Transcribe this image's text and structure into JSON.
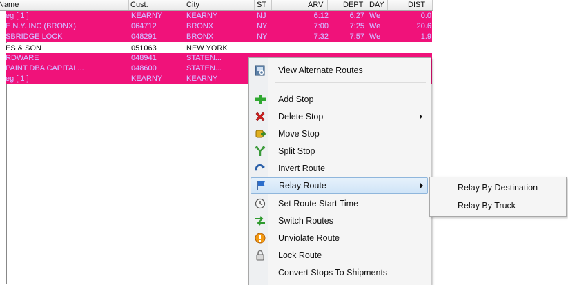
{
  "grid": {
    "columns": [
      "Name",
      "Cust.",
      "City",
      "ST",
      "ARV",
      "DEPT",
      "DAY",
      "DIST"
    ],
    "rows": [
      {
        "style": "pink",
        "name": "eg [ 1 ]",
        "cust": "KEARNY",
        "city": "KEARNY",
        "st": "NJ",
        "arv": "6:12",
        "dept": "6:27",
        "day": "We",
        "dist": "0.0"
      },
      {
        "style": "pink",
        "name": "E N.Y. INC (BRONX)",
        "cust": "064712",
        "city": "BRONX",
        "st": "NY",
        "arv": "7:00",
        "dept": "7:25",
        "day": "We",
        "dist": "20.6"
      },
      {
        "style": "pink",
        "name": "SBRIDGE LOCK",
        "cust": "048291",
        "city": "BRONX",
        "st": "NY",
        "arv": "7:32",
        "dept": "7:57",
        "day": "We",
        "dist": "1.9"
      },
      {
        "style": "white",
        "name": "ES & SON",
        "cust": "051063",
        "city": "NEW YORK",
        "st": "",
        "arv": "",
        "dept": "",
        "day": "",
        "dist": ""
      },
      {
        "style": "pink",
        "name": "RDWARE",
        "cust": "048941",
        "city": "STATEN...",
        "st": "",
        "arv": "",
        "dept": "",
        "day": "",
        "dist": ""
      },
      {
        "style": "pink",
        "name": "PAINT DBA CAPITAL...",
        "cust": "048600",
        "city": "STATEN...",
        "st": "",
        "arv": "",
        "dept": "",
        "day": "",
        "dist": ""
      },
      {
        "style": "pink",
        "name": "eg [ 1 ]",
        "cust": "KEARNY",
        "city": "KEARNY",
        "st": "",
        "arv": "",
        "dept": "",
        "day": "",
        "dist": ""
      }
    ]
  },
  "menu": {
    "items": [
      {
        "label": "View Alternate Routes",
        "icon": "view-routes-icon"
      },
      {
        "label": "Add Stop",
        "icon": "add-plus-icon"
      },
      {
        "label": "Delete Stop",
        "icon": "delete-x-icon",
        "submenu": true
      },
      {
        "label": "Move Stop",
        "icon": "move-stop-icon"
      },
      {
        "label": "Split Stop",
        "icon": "split-icon"
      },
      {
        "label": "Invert Route",
        "icon": "invert-arrow-icon"
      },
      {
        "label": "Relay Route",
        "icon": "flag-icon",
        "submenu": true,
        "highlighted": true
      },
      {
        "label": "Set Route Start Time",
        "icon": "clock-icon"
      },
      {
        "label": "Switch Routes",
        "icon": "switch-arrows-icon"
      },
      {
        "label": "Unviolate Route",
        "icon": "warning-icon"
      },
      {
        "label": "Lock Route",
        "icon": "lock-icon"
      },
      {
        "label": "Convert Stops To Shipments",
        "icon": ""
      }
    ]
  },
  "submenu": {
    "items": [
      {
        "label": "Relay By Destination"
      },
      {
        "label": "Relay By Truck"
      }
    ]
  },
  "colors": {
    "row_pink": "#f0127a",
    "row_pink_text": "#d7b5ff",
    "highlight": "#cfe4f7"
  }
}
